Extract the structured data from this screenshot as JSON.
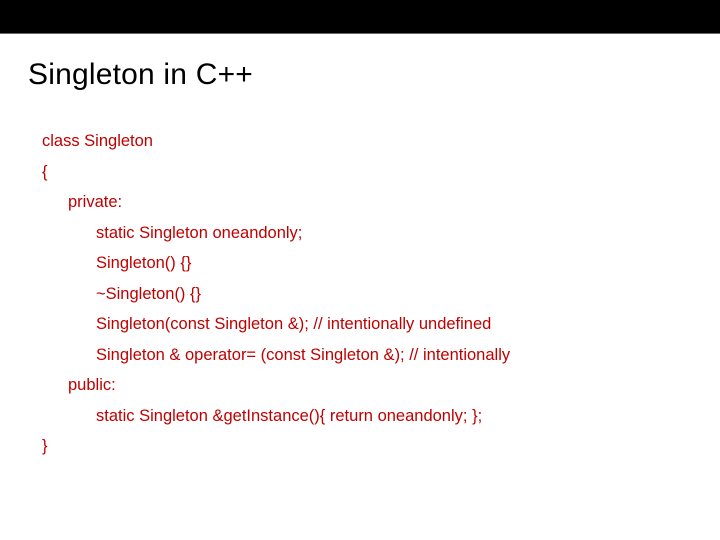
{
  "title": "Singleton in C++",
  "code": {
    "l0": "class Singleton",
    "l1": "{",
    "l2": "private:",
    "l3": "static Singleton oneandonly;",
    "l4": "Singleton() {}",
    "l5": "~Singleton() {}",
    "l6": "Singleton(const Singleton &);  // intentionally undefined",
    "l7": "Singleton & operator= (const Singleton &); // intentionally",
    "l8": "public:",
    "l9": "static Singleton &getInstance(){ return oneandonly; };",
    "l10": "}"
  }
}
